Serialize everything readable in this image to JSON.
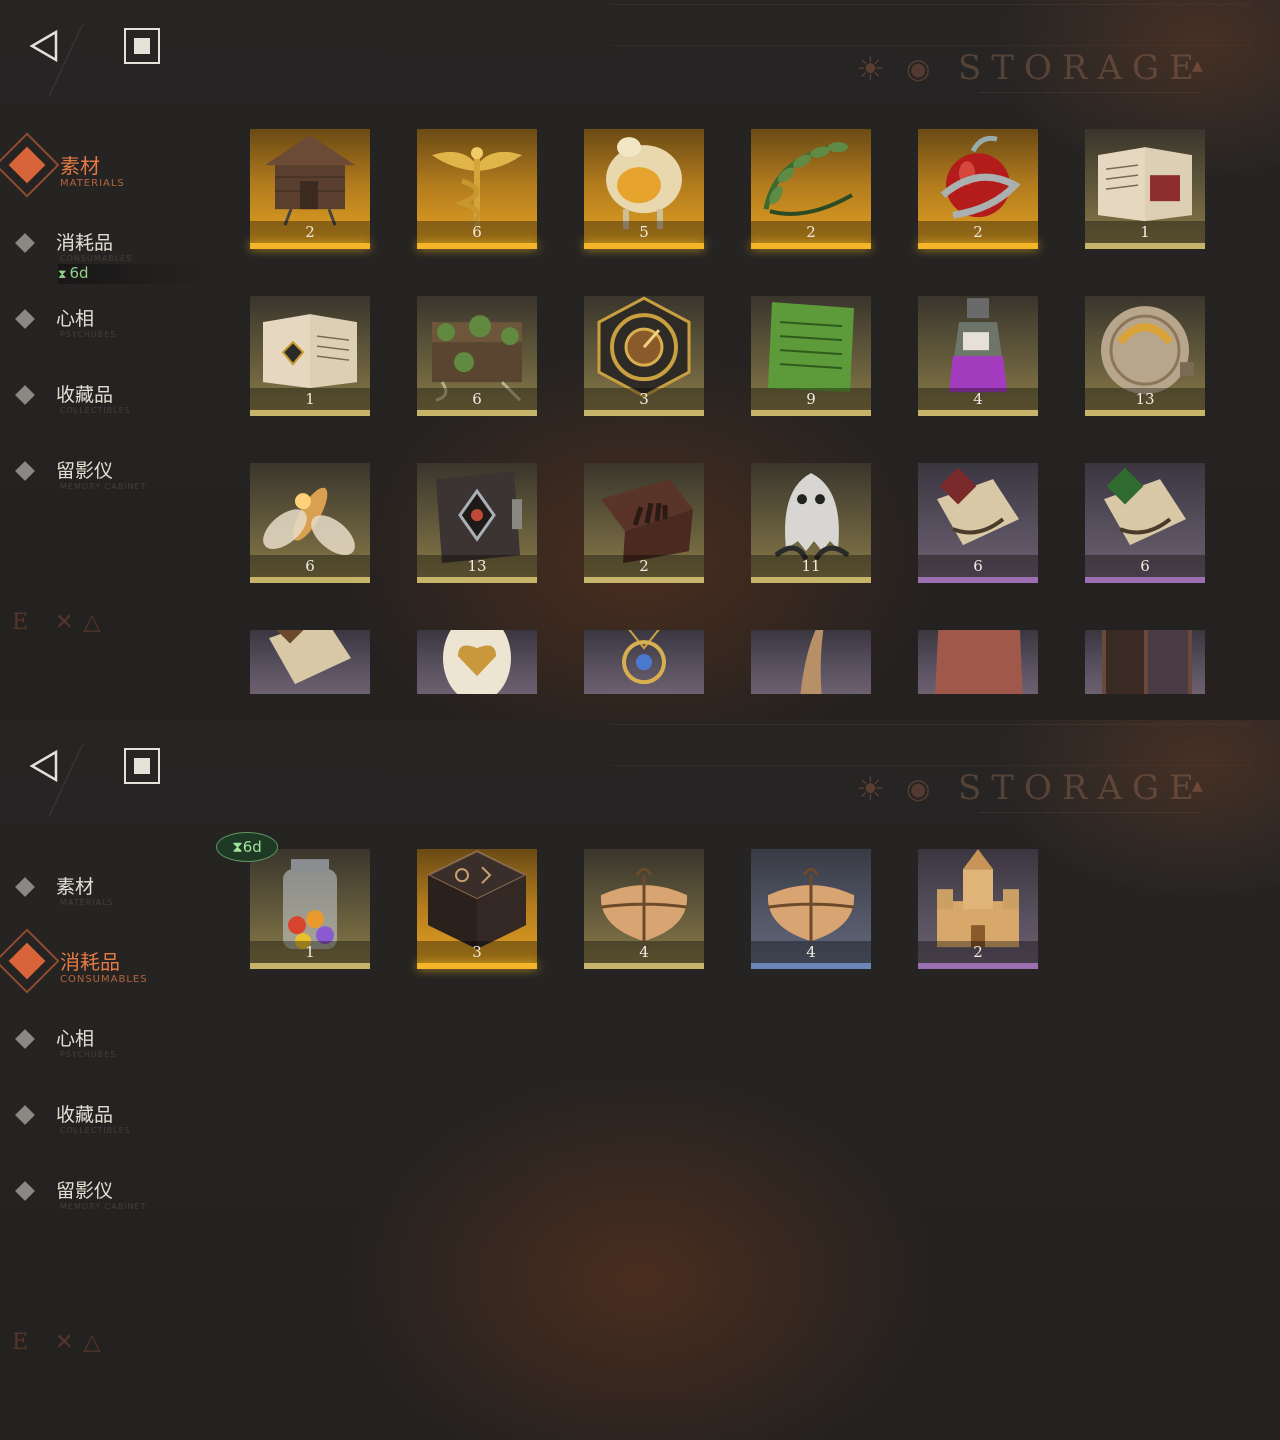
{
  "storage_title": "STORAGE",
  "top": {
    "nav": [
      {
        "label": "素材",
        "sub": "MATERIALS",
        "active": true
      },
      {
        "label": "消耗品",
        "sub": "CONSUMABLES",
        "active": false
      },
      {
        "label": "心相",
        "sub": "PSYCHUBES",
        "active": false
      },
      {
        "label": "收藏品",
        "sub": "COLLECTIBLES",
        "active": false
      },
      {
        "label": "留影仪",
        "sub": "MEMORY CABINET",
        "active": false
      }
    ],
    "timer": "6d",
    "items": [
      {
        "name": "hut-item",
        "count": "2",
        "rarity": "gold"
      },
      {
        "name": "caduceus-item",
        "count": "6",
        "rarity": "gold"
      },
      {
        "name": "golden-sheep-item",
        "count": "5",
        "rarity": "gold"
      },
      {
        "name": "laurel-wreath-item",
        "count": "2",
        "rarity": "gold"
      },
      {
        "name": "apple-serpent-item",
        "count": "2",
        "rarity": "gold"
      },
      {
        "name": "red-rune-book-item",
        "count": "1",
        "rarity": "olive"
      },
      {
        "name": "gold-rune-book-item",
        "count": "1",
        "rarity": "olive"
      },
      {
        "name": "overgrown-chest-item",
        "count": "6",
        "rarity": "olive"
      },
      {
        "name": "astrolabe-item",
        "count": "3",
        "rarity": "olive"
      },
      {
        "name": "green-tablet-item",
        "count": "9",
        "rarity": "olive"
      },
      {
        "name": "potion-bottle-item",
        "count": "4",
        "rarity": "olive"
      },
      {
        "name": "brass-device-item",
        "count": "13",
        "rarity": "olive"
      },
      {
        "name": "glowing-moth-item",
        "count": "6",
        "rarity": "olive"
      },
      {
        "name": "dark-tome-item",
        "count": "13",
        "rarity": "olive"
      },
      {
        "name": "hand-box-item",
        "count": "2",
        "rarity": "olive"
      },
      {
        "name": "ghost-item",
        "count": "11",
        "rarity": "olive"
      },
      {
        "name": "red-seal-scroll-item",
        "count": "6",
        "rarity": "purple"
      },
      {
        "name": "green-seal-scroll-item",
        "count": "6",
        "rarity": "purple"
      },
      {
        "name": "scroll-item",
        "count": "",
        "rarity": "purple"
      },
      {
        "name": "heart-egg-item",
        "count": "",
        "rarity": "purple"
      },
      {
        "name": "amulet-item",
        "count": "",
        "rarity": "purple"
      },
      {
        "name": "horn-item",
        "count": "",
        "rarity": "purple"
      },
      {
        "name": "stone-tablet-item",
        "count": "",
        "rarity": "purple"
      },
      {
        "name": "frame-item",
        "count": "",
        "rarity": "purple"
      }
    ]
  },
  "bottom": {
    "nav": [
      {
        "label": "素材",
        "sub": "MATERIALS",
        "active": false
      },
      {
        "label": "消耗品",
        "sub": "CONSUMABLES",
        "active": true
      },
      {
        "label": "心相",
        "sub": "PSYCHUBES",
        "active": false
      },
      {
        "label": "收藏品",
        "sub": "COLLECTIBLES",
        "active": false
      },
      {
        "label": "留影仪",
        "sub": "MEMORY CABINET",
        "active": false
      }
    ],
    "item_timer": "6d",
    "items": [
      {
        "name": "candy-jar-item",
        "count": "1",
        "rarity": "olive"
      },
      {
        "name": "rune-cube-item",
        "count": "3",
        "rarity": "gold"
      },
      {
        "name": "parcel-item",
        "count": "4",
        "rarity": "olive"
      },
      {
        "name": "parcel-blue-item",
        "count": "4",
        "rarity": "blue"
      },
      {
        "name": "castle-item",
        "count": "2",
        "rarity": "purple"
      }
    ]
  }
}
